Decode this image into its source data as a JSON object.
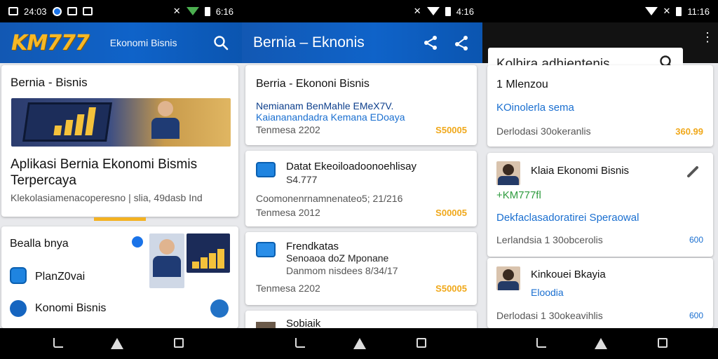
{
  "statusbar": {
    "left_time": "24:03",
    "middle_time": "4:16",
    "right_time": "11:16",
    "left_right_time": "6:16"
  },
  "screen1": {
    "logo": "KM777",
    "header_sub": "Ekonomi Bisnis",
    "section_title": "Bernia - Bisnis",
    "headline": "Aplikasi Bernia Ekonomi Bismis Terpercaya",
    "headline_meta": "Klekolasiamenacoperesno | slia, 49dasb Ind",
    "list_title": "Bealla bnya",
    "items": [
      {
        "label": "PlanZ0vai"
      },
      {
        "label": "Konomi Bisnis"
      }
    ]
  },
  "screen2": {
    "title": "Bernia – Eknonis",
    "card_title": "Berria - Ekononi Bisnis",
    "card_line1": "Nemianam BenMahle EMeX7V.",
    "card_line2": "Kaiananandadra Kemana EDoaya",
    "card_meta": "Tenmesa 2202",
    "card_price": "S50005",
    "articles": [
      {
        "title": "Datat Ekeoiloadoonoehlisay",
        "sub": "S4.777",
        "meta1": "Coomonenrnamnenateo5; 21/216",
        "meta2": "Tenmesa 2012",
        "price": "S00005"
      },
      {
        "title": "Frendkatas",
        "sub": "Senoaoa doZ Mponane",
        "meta1": "Danmom nisdees 8/34/17",
        "meta2": "Tenmesa 2202",
        "price": "S50005"
      },
      {
        "title": "Sobiaik"
      }
    ]
  },
  "screen3": {
    "search_text": "Kolhira adhientenis",
    "cards": [
      {
        "title": "1 Mlenzou",
        "sub": "KOinolerla sema",
        "meta": "Derlodasi 30okeranlis",
        "price": "360.99"
      },
      {
        "title": "Klaia Ekonomi Bisnis",
        "sub": "+KM777fl",
        "line": "Dekfaclasadoratirei Speraowal",
        "meta": "Lerlandsia 1 30obcerolis",
        "price": "600"
      },
      {
        "title": "Kinkouei Bkayia",
        "sub": "Eloodia",
        "meta": "Derlodasi 1 30okeavihlis",
        "price": "600"
      }
    ]
  },
  "colors": {
    "appbar": "#0f63c9",
    "accent": "#f4b221",
    "link": "#1a6fd0"
  }
}
